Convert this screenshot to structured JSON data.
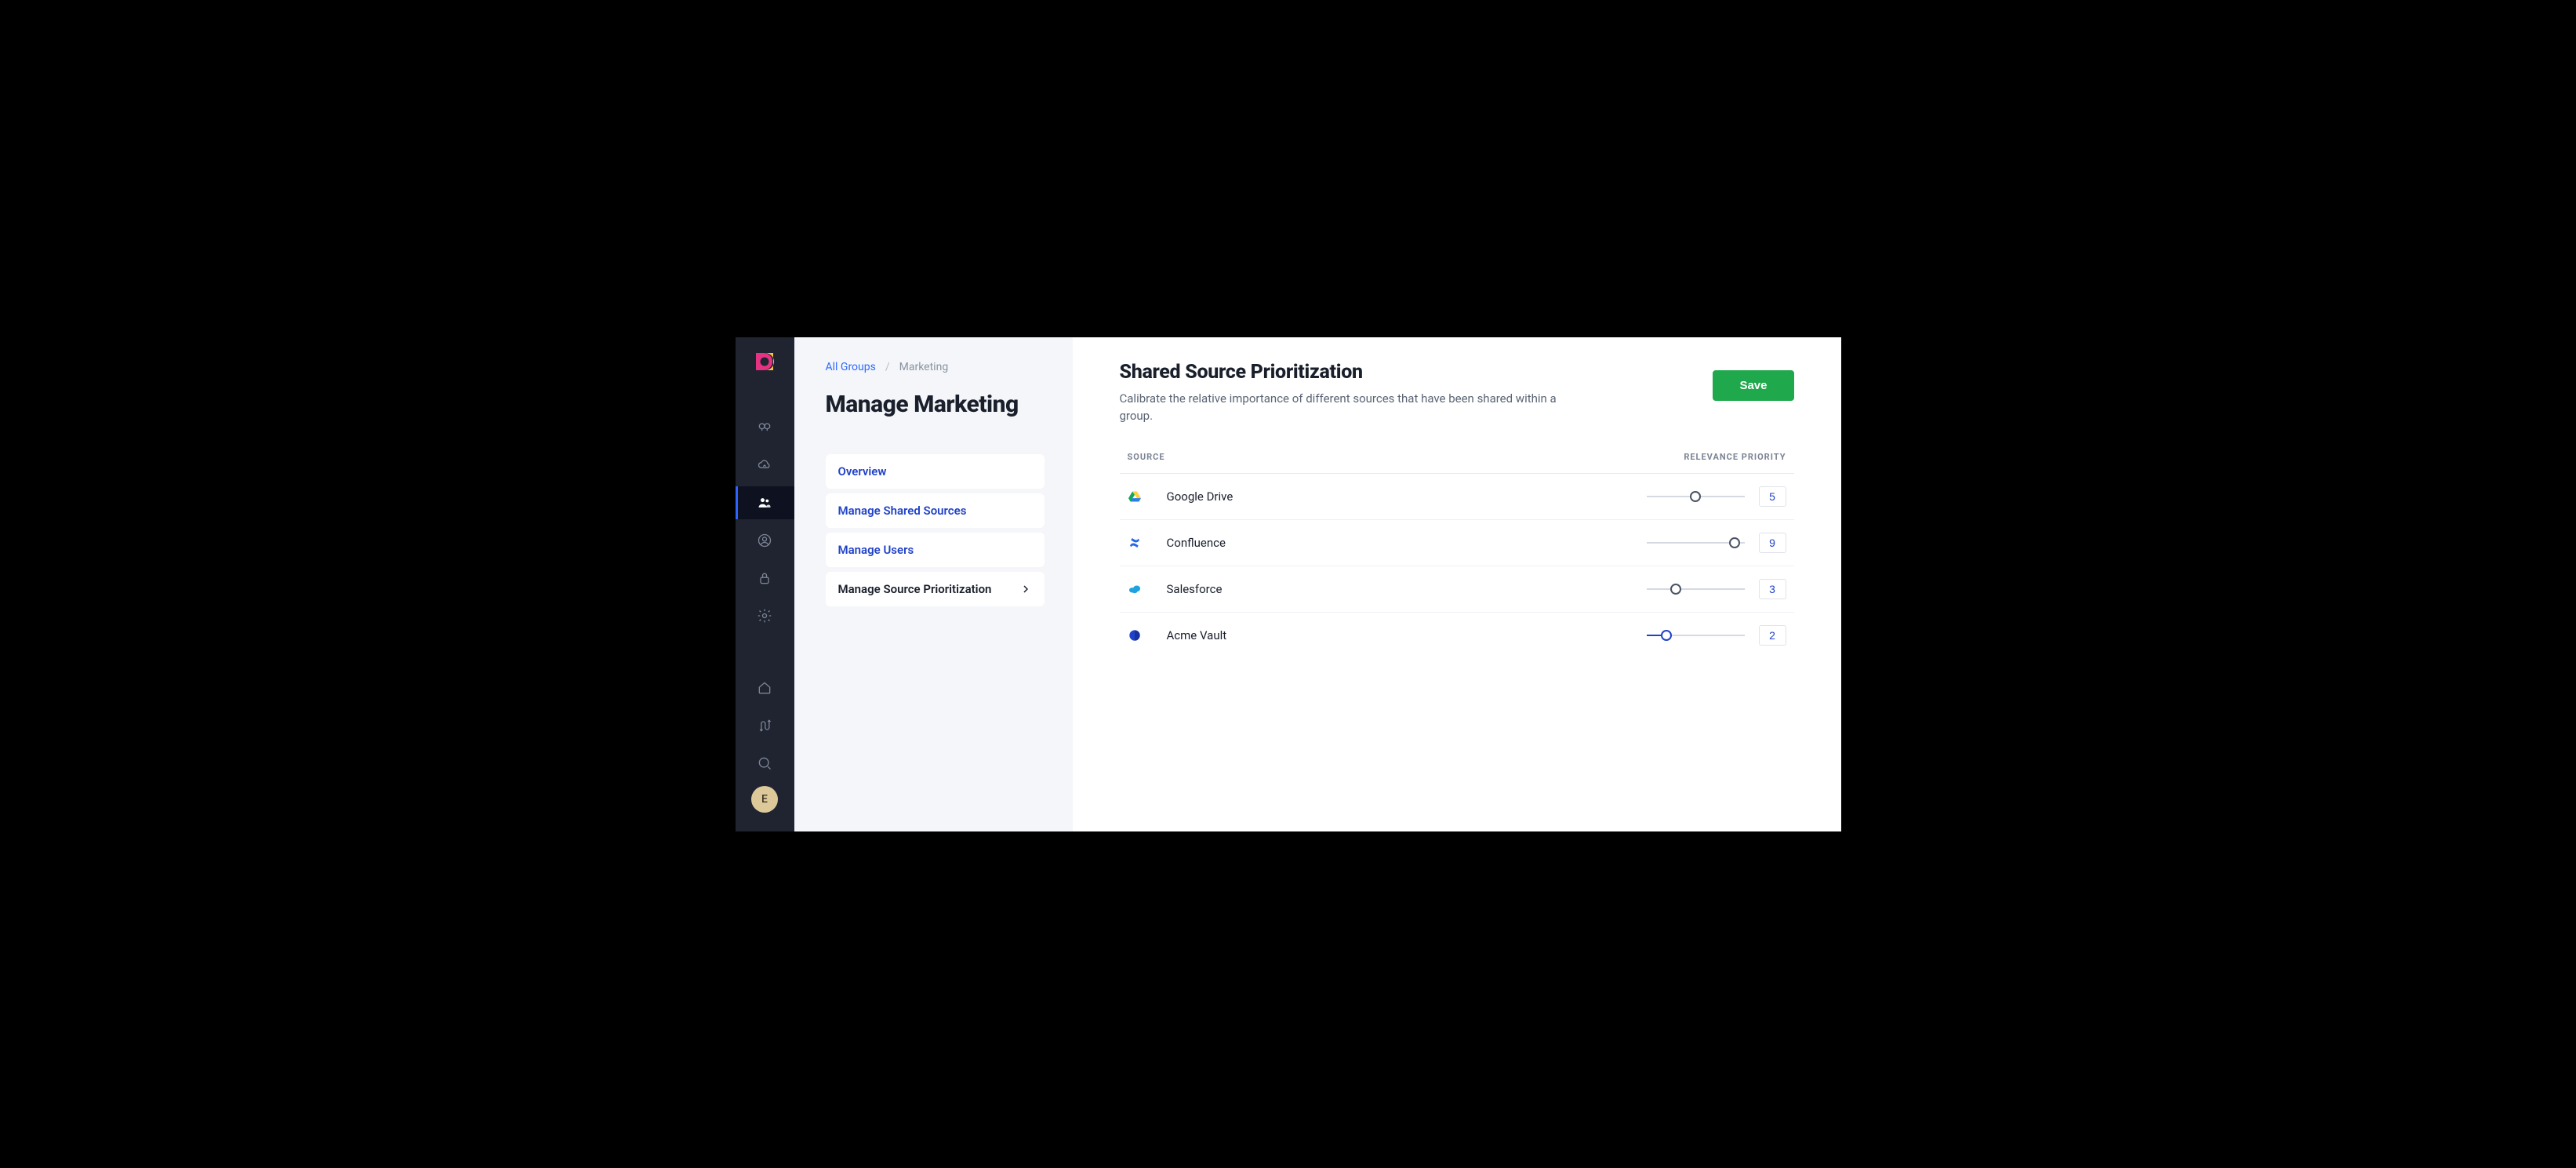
{
  "user": {
    "avatar_initial": "E"
  },
  "breadcrumb": {
    "all_groups": "All Groups",
    "separator": "/",
    "current": "Marketing"
  },
  "page_title": "Manage Marketing",
  "subnav": {
    "overview": "Overview",
    "manage_shared_sources": "Manage Shared Sources",
    "manage_users": "Manage Users",
    "manage_source_prioritization": "Manage Source Prioritization"
  },
  "section": {
    "title": "Shared Source Prioritization",
    "subtitle": "Calibrate the relative importance of different sources that have been shared within a group.",
    "save_label": "Save"
  },
  "table": {
    "col_source": "SOURCE",
    "col_priority": "RELEVANCE PRIORITY",
    "max": 10,
    "rows": [
      {
        "name": "Google Drive",
        "value": 5,
        "icon": "gdrive"
      },
      {
        "name": "Confluence",
        "value": 9,
        "icon": "confluence"
      },
      {
        "name": "Salesforce",
        "value": 3,
        "icon": "salesforce"
      },
      {
        "name": "Acme Vault",
        "value": 2,
        "icon": "acme"
      }
    ]
  }
}
